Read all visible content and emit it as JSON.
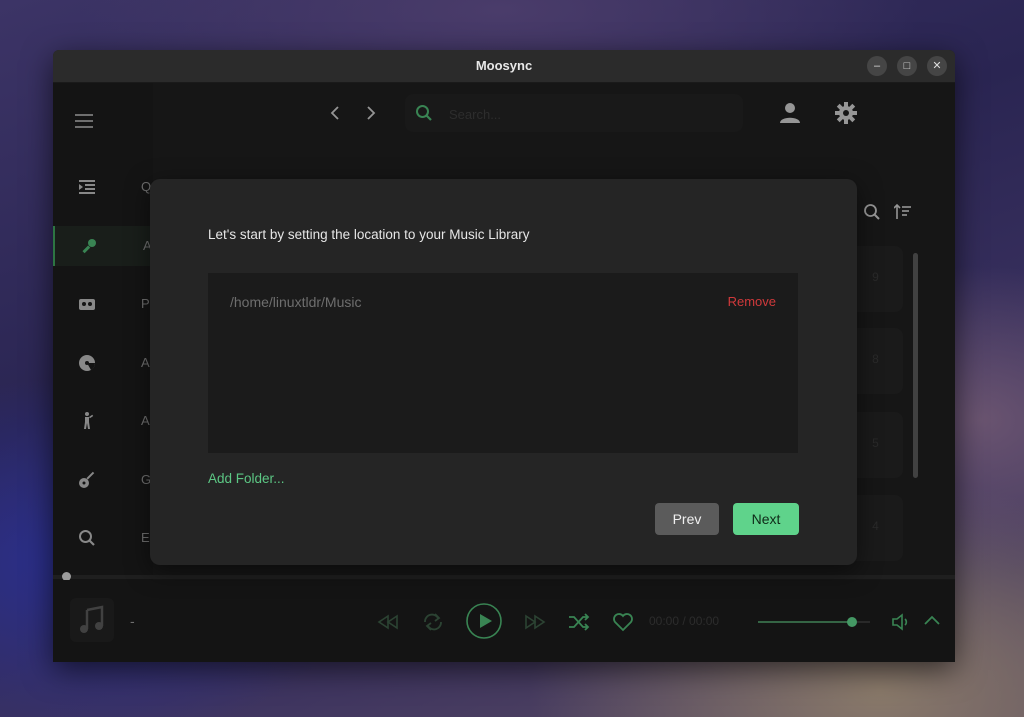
{
  "window": {
    "title": "Moosync",
    "controls": {
      "minimize": "–",
      "maximize": "□",
      "close": "✕"
    }
  },
  "sidebar": {
    "items": [
      {
        "label": "Q",
        "icon": "queue-icon",
        "active": false
      },
      {
        "label": "A",
        "icon": "microphone-icon",
        "active": true
      },
      {
        "label": "P",
        "icon": "cassette-icon",
        "active": false
      },
      {
        "label": "A",
        "icon": "disc-icon",
        "active": false
      },
      {
        "label": "A",
        "icon": "artist-icon",
        "active": false
      },
      {
        "label": "G",
        "icon": "guitar-icon",
        "active": false
      },
      {
        "label": "E",
        "icon": "explore-search-icon",
        "active": false
      }
    ]
  },
  "header": {
    "search": {
      "placeholder": "Search...",
      "value": ""
    }
  },
  "background_rows": [
    "9",
    "8",
    "5",
    "4"
  ],
  "player": {
    "track_title": "-",
    "time": "00:00 / 00:00",
    "volume": 0.84
  },
  "modal": {
    "prompt": "Let's start by setting the location to your Music Library",
    "folders": [
      {
        "path": "/home/linuxtldr/Music",
        "remove_label": "Remove"
      }
    ],
    "add_folder_label": "Add Folder...",
    "prev_label": "Prev",
    "next_label": "Next"
  },
  "colors": {
    "accent": "#5fd38b",
    "danger": "#d0393b",
    "window_bg": "#1f1f1f",
    "modal_bg": "#252525"
  }
}
